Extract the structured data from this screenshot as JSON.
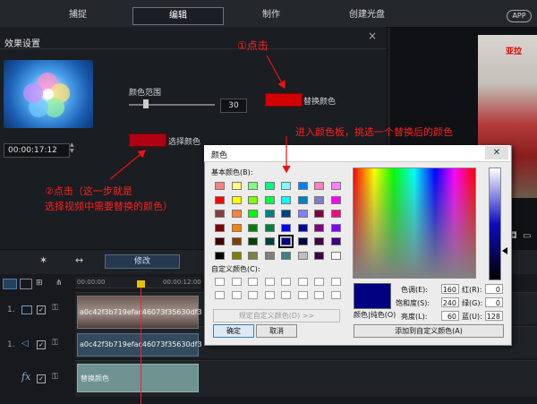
{
  "top_tabs": [
    {
      "label": "捕捉",
      "active": false
    },
    {
      "label": "编辑",
      "active": true
    },
    {
      "label": "制作",
      "active": false
    },
    {
      "label": "创建光盘",
      "active": false
    }
  ],
  "app_badge": "APP",
  "effect_panel": {
    "title": "效果设置",
    "close": "×",
    "timecode": "00:00:17:12",
    "color_range_label": "颜色范围",
    "color_range_value": "30",
    "select_color_label": "选择颜色",
    "replace_color_label": "替换颜色",
    "replace_color": "#d20000",
    "select_color": "#b00014"
  },
  "preview": {
    "overlay_text": "亚拉"
  },
  "midbar": {
    "modify_button": "修改"
  },
  "timeline": {
    "ruler": [
      "00:00:00",
      "00:00:12:00"
    ],
    "tracks": [
      {
        "label": "1.",
        "clip": "a0c42f3b719efac46073f35630df3"
      },
      {
        "label": "1.",
        "clip": "a0c42f3b719efac46073f35630df3"
      },
      {
        "label": "fx",
        "clip": "替换颜色"
      }
    ]
  },
  "color_dialog": {
    "title": "颜色",
    "close": "✕",
    "basic_colors_label": "基本颜色(B):",
    "custom_colors_label": "自定义颜色(C):",
    "define_custom_button": "规定自定义颜色(D) >>",
    "ok_button": "确定",
    "cancel_button": "取消",
    "color_solid_label": "颜色|纯色(O)",
    "add_custom_button": "添加到自定义颜色(A)",
    "fields": [
      {
        "label": "色调(E):",
        "value": "160"
      },
      {
        "label": "饱和度(S):",
        "value": "240"
      },
      {
        "label": "亮度(L):",
        "value": "60"
      },
      {
        "label": "红(R):",
        "value": "0"
      },
      {
        "label": "绿(G):",
        "value": "0"
      },
      {
        "label": "蓝(U):",
        "value": "128"
      }
    ],
    "basic_colors": [
      [
        "#ff8080",
        "#ffff80",
        "#80ff80",
        "#00ff80",
        "#80ffff",
        "#0080ff",
        "#ff80c0",
        "#ff80ff"
      ],
      [
        "#ff0000",
        "#ffff00",
        "#80ff00",
        "#00ff40",
        "#00ffff",
        "#0080c0",
        "#8080c0",
        "#ff00ff"
      ],
      [
        "#804040",
        "#ff8040",
        "#00ff00",
        "#008080",
        "#004080",
        "#8080ff",
        "#800040",
        "#ff0080"
      ],
      [
        "#800000",
        "#ff8000",
        "#008000",
        "#008040",
        "#0000ff",
        "#0000a0",
        "#800080",
        "#8000ff"
      ],
      [
        "#400000",
        "#804000",
        "#004000",
        "#004040",
        "#000080",
        "#000040",
        "#400040",
        "#400080"
      ],
      [
        "#000000",
        "#808000",
        "#808040",
        "#808080",
        "#408080",
        "#c0c0c0",
        "#400040",
        "#ffffff"
      ]
    ],
    "current_color": "#000080"
  },
  "annotations": {
    "click1": "①点击",
    "enter_palette": "进入颜色板，挑选一个替换后的颜色",
    "click2_line1": "②点击（这一步就是",
    "click2_line2": "选择视频中需要替换的颜色）"
  }
}
